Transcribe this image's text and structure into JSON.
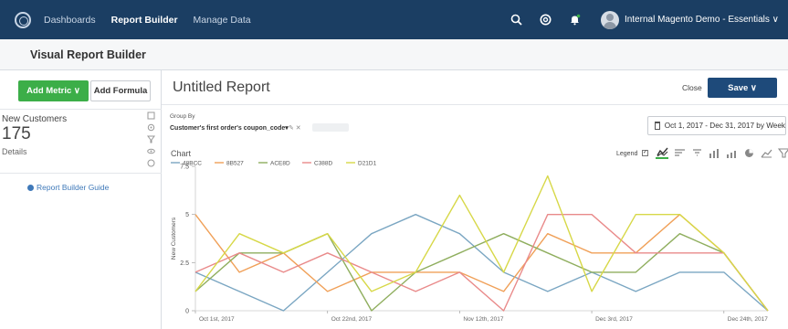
{
  "nav": {
    "items": [
      {
        "label": "Dashboards",
        "active": false
      },
      {
        "label": "Report Builder",
        "active": true
      },
      {
        "label": "Manage Data",
        "active": false
      }
    ],
    "account": "Internal Magento Demo - Essentials ∨"
  },
  "subheader": {
    "title": "Visual Report Builder"
  },
  "left": {
    "add_metric": "Add Metric ∨",
    "add_formula": "Add Formula",
    "metric": {
      "name": "New Customers",
      "value": "175",
      "details": "Details"
    },
    "guide": "Report Builder Guide"
  },
  "main": {
    "title": "Untitled Report",
    "close": "Close",
    "save": "Save ∨",
    "group_by_label": "Group By",
    "group_by_value": "Customer's first order's coupon_code▾",
    "date_range": "Oct 1, 2017 - Dec 31, 2017 by Week",
    "chart_label": "Chart",
    "legend_label": "Legend"
  },
  "colors": {
    "nav_bg": "#1b3e63",
    "green": "#3cae48",
    "save_blue": "#1e4a7a"
  },
  "chart_data": {
    "type": "line",
    "ylabel": "New Customers",
    "ylim": [
      0,
      7.5
    ],
    "yticks": [
      "0",
      "2.5",
      "5",
      "7.5"
    ],
    "x": [
      "Oct 1st, 2017",
      "Oct 8th",
      "Oct 15th",
      "Oct 22nd, 2017",
      "Oct 29th",
      "Nov 5th",
      "Nov 12th, 2017",
      "Nov 19th",
      "Nov 26th",
      "Dec 3rd, 2017",
      "Dec 10th",
      "Dec 17th",
      "Dec 24th, 2017",
      "Dec 31st"
    ],
    "xtick_labels": [
      {
        "index": 0,
        "label": "Oct 1st, 2017"
      },
      {
        "index": 3,
        "label": "Oct 22nd, 2017"
      },
      {
        "index": 6,
        "label": "Nov 12th, 2017"
      },
      {
        "index": 9,
        "label": "Dec 3rd, 2017"
      },
      {
        "index": 12,
        "label": "Dec 24th, 2017"
      }
    ],
    "series": [
      {
        "name": "48BCC",
        "color": "#7aa6c2",
        "values": [
          2,
          1,
          0,
          2,
          4,
          5,
          4,
          2,
          1,
          2,
          1,
          2,
          2,
          0
        ]
      },
      {
        "name": "8B527",
        "color": "#f0a058",
        "values": [
          5,
          2,
          3,
          1,
          2,
          2,
          2,
          1,
          4,
          3,
          3,
          5,
          3,
          0
        ]
      },
      {
        "name": "ACE8D",
        "color": "#8fae5e",
        "values": [
          1,
          3,
          3,
          4,
          0,
          2,
          3,
          4,
          3,
          2,
          2,
          4,
          3,
          0
        ]
      },
      {
        "name": "C388D",
        "color": "#e98a8a",
        "values": [
          2,
          3,
          2,
          3,
          2,
          1,
          2,
          0,
          5,
          5,
          3,
          3,
          3,
          0
        ]
      },
      {
        "name": "D21D1",
        "color": "#d7d848",
        "values": [
          1,
          4,
          3,
          4,
          1,
          2,
          6,
          2,
          7,
          1,
          5,
          5,
          3,
          0
        ]
      }
    ]
  }
}
